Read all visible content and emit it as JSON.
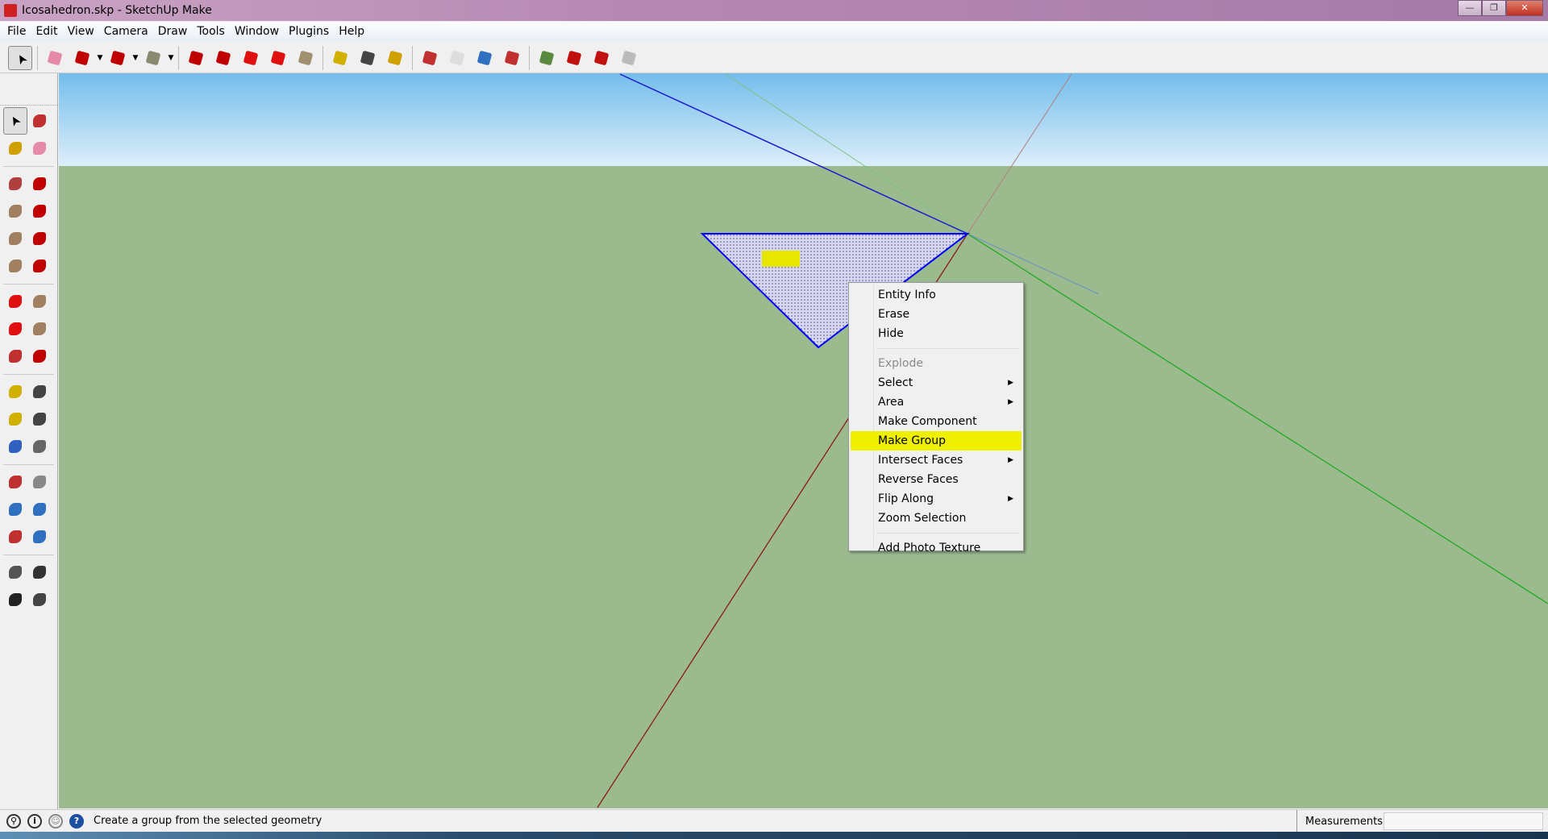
{
  "window": {
    "title": "Icosahedron.skp - SketchUp Make",
    "minimize": "—",
    "maximize": "❐",
    "close": "✕"
  },
  "menu": [
    "File",
    "Edit",
    "View",
    "Camera",
    "Draw",
    "Tools",
    "Window",
    "Plugins",
    "Help"
  ],
  "toolbar": [
    {
      "name": "select",
      "color": "#000"
    },
    {
      "sep": true
    },
    {
      "name": "make-component",
      "color": "#e58aa8"
    },
    {
      "name": "line",
      "color": "#c00000",
      "drop": true
    },
    {
      "name": "arc",
      "color": "#c00000",
      "drop": true
    },
    {
      "name": "rectangle",
      "color": "#8a8a70",
      "drop": true
    },
    {
      "sep": true
    },
    {
      "name": "push-pull",
      "color": "#c00000"
    },
    {
      "name": "follow-me",
      "color": "#c00000"
    },
    {
      "name": "move",
      "color": "#e01010"
    },
    {
      "name": "rotate",
      "color": "#e01010"
    },
    {
      "name": "scale",
      "color": "#a09070"
    },
    {
      "sep": true
    },
    {
      "name": "tape-measure",
      "color": "#d0b000"
    },
    {
      "name": "text",
      "color": "#444"
    },
    {
      "name": "paint-bucket",
      "color": "#d0a000"
    },
    {
      "sep": true
    },
    {
      "name": "orbit",
      "color": "#c03030"
    },
    {
      "name": "pan",
      "color": "#ddd"
    },
    {
      "name": "zoom",
      "color": "#3070c0"
    },
    {
      "name": "zoom-extents",
      "color": "#c03030"
    },
    {
      "sep": true
    },
    {
      "name": "get-models",
      "color": "#5a8a40"
    },
    {
      "name": "share-model",
      "color": "#c01010"
    },
    {
      "name": "share-component",
      "color": "#c01010"
    },
    {
      "name": "extension-warehouse",
      "color": "#bbb"
    }
  ],
  "left_toolbar": [
    [
      {
        "name": "select",
        "color": "#000",
        "sel": true
      },
      {
        "name": "make-component",
        "color": "#c03030"
      }
    ],
    [
      {
        "name": "paint-bucket",
        "color": "#d0a000"
      },
      {
        "name": "eraser",
        "color": "#e58aa8"
      }
    ],
    "sep",
    [
      {
        "name": "rectangle",
        "color": "#b04040"
      },
      {
        "name": "line",
        "color": "#c00000"
      }
    ],
    [
      {
        "name": "circle",
        "color": "#a08060"
      },
      {
        "name": "freehand",
        "color": "#c00000"
      }
    ],
    [
      {
        "name": "polygon",
        "color": "#a08060"
      },
      {
        "name": "arc",
        "color": "#c00000"
      }
    ],
    [
      {
        "name": "rotated-rectangle",
        "color": "#a08060"
      },
      {
        "name": "pie",
        "color": "#c00000"
      }
    ],
    "sep",
    [
      {
        "name": "move",
        "color": "#e01010"
      },
      {
        "name": "push-pull",
        "color": "#a08060"
      }
    ],
    [
      {
        "name": "rotate",
        "color": "#e01010"
      },
      {
        "name": "follow-me",
        "color": "#a08060"
      }
    ],
    [
      {
        "name": "scale",
        "color": "#c03030"
      },
      {
        "name": "offset",
        "color": "#c00000"
      }
    ],
    "sep",
    [
      {
        "name": "tape-measure",
        "color": "#d0b000"
      },
      {
        "name": "dimension",
        "color": "#444"
      }
    ],
    [
      {
        "name": "protractor",
        "color": "#d0b000"
      },
      {
        "name": "text",
        "color": "#444"
      }
    ],
    [
      {
        "name": "axes",
        "color": "#3060c0"
      },
      {
        "name": "3d-text",
        "color": "#666"
      }
    ],
    "sep",
    [
      {
        "name": "orbit",
        "color": "#c03030"
      },
      {
        "name": "pan",
        "color": "#888"
      }
    ],
    [
      {
        "name": "zoom",
        "color": "#3070c0"
      },
      {
        "name": "zoom-window",
        "color": "#3070c0"
      }
    ],
    [
      {
        "name": "zoom-extents",
        "color": "#c03030"
      },
      {
        "name": "previous-view",
        "color": "#3070c0"
      }
    ],
    "sep",
    [
      {
        "name": "position-camera",
        "color": "#555"
      },
      {
        "name": "look-around",
        "color": "#333"
      }
    ],
    [
      {
        "name": "walk",
        "color": "#222"
      },
      {
        "name": "section-plane",
        "color": "#444"
      }
    ]
  ],
  "context_menu": {
    "items": [
      {
        "label": "Entity Info"
      },
      {
        "label": "Erase"
      },
      {
        "label": "Hide"
      },
      {
        "sep": true
      },
      {
        "label": "Explode",
        "disabled": true
      },
      {
        "label": "Select",
        "submenu": true
      },
      {
        "label": "Area",
        "submenu": true
      },
      {
        "label": "Make Component"
      },
      {
        "label": "Make Group",
        "highlighted": true
      },
      {
        "label": "Intersect Faces",
        "submenu": true
      },
      {
        "label": "Reverse Faces"
      },
      {
        "label": "Flip Along",
        "submenu": true
      },
      {
        "label": "Zoom Selection"
      },
      {
        "sep": true
      },
      {
        "label": "Add Photo Texture"
      }
    ],
    "highlight_color": "#eef000"
  },
  "status": {
    "text": "Create a group from the selected geometry",
    "measurements_label": "Measurements",
    "measurements_value": ""
  },
  "colors": {
    "sky": "#7fc4ee",
    "ground": "#9bbb8f",
    "axis_red": "#8b1a1a",
    "axis_green": "#1faa1f",
    "axis_blue": "#1a1ad0",
    "selection": "#0000ff"
  }
}
